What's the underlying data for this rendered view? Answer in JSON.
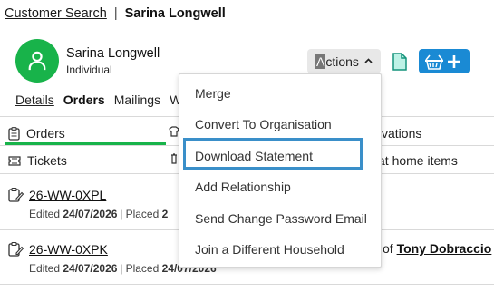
{
  "breadcrumb": {
    "link": "Customer Search",
    "separator": "|",
    "current": "Sarina Longwell"
  },
  "customer": {
    "name": "Sarina Longwell",
    "type": "Individual",
    "avatar_color": "#18b34a"
  },
  "toolbar": {
    "actions_label_cursor": "A",
    "actions_label_rest": "ctions",
    "doc_icon": "document-icon",
    "basket_icon": "basket-add-icon",
    "basket_color": "#1a8ad4"
  },
  "tabs": [
    {
      "label": "Details"
    },
    {
      "label": "Orders"
    },
    {
      "label": "Mailings"
    },
    {
      "label": "W"
    }
  ],
  "subtabs": {
    "orders": "Orders",
    "tickets": "Tickets",
    "reservations_fragment": "vations",
    "home_items_fragment": "at home items"
  },
  "orders": [
    {
      "ref": "26-WW-0XPL",
      "edited_label": "Edited",
      "edited_date": "24/07/2026",
      "placed_label": "Placed",
      "placed_date": "2"
    },
    {
      "ref": "26-WW-0XPK",
      "edited_label": "Edited",
      "edited_date": "24/07/2026",
      "placed_label": "Placed",
      "placed_date": "24/07/2026"
    }
  ],
  "right_row": {
    "prefix": "of",
    "person": "Tony Dobraccio"
  },
  "actions_menu": {
    "items": [
      "Merge",
      "Convert To Organisation",
      "Download Statement",
      "Add Relationship",
      "Send Change Password Email",
      "Join a Different Household"
    ],
    "highlighted_index": 2,
    "highlight_color": "#3a8fc9"
  }
}
